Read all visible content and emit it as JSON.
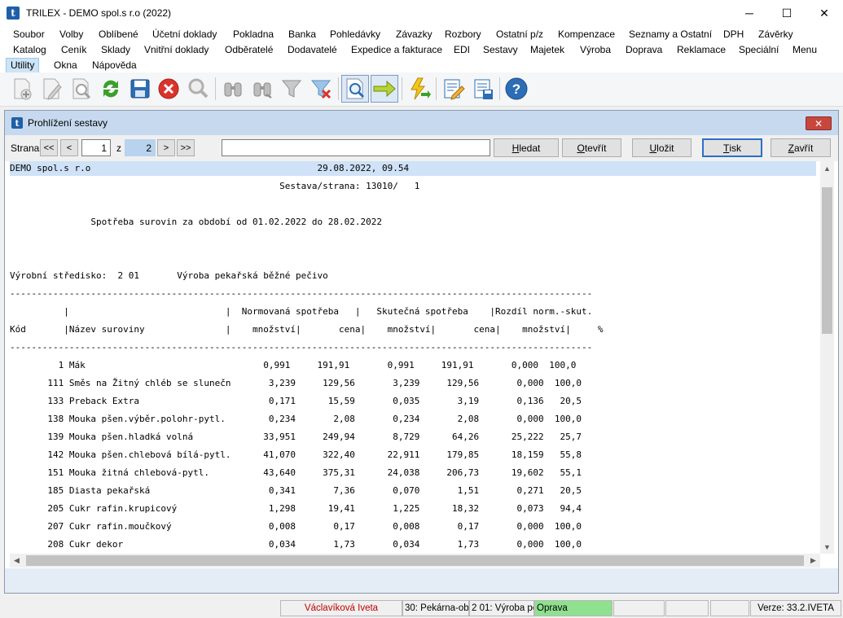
{
  "window": {
    "title": "TRILEX - DEMO spol.s r.o (2022)",
    "logo_letter": "t",
    "minimize": "─",
    "maximize": "☐",
    "close": "✕"
  },
  "menu": {
    "row1": [
      "Soubor",
      "Volby",
      "Oblíbené",
      "Účetní doklady",
      "Pokladna",
      "Banka",
      "Pohledávky",
      "Závazky",
      "Rozbory",
      "Ostatní p/z",
      "Kompenzace",
      "Seznamy a Ostatní",
      "DPH",
      "Závěrky"
    ],
    "row2": [
      "Katalog",
      "Ceník",
      "Sklady",
      "Vnitřní doklady",
      "Odběratelé",
      "Dodavatelé",
      "Expedice a fakturace",
      "EDI",
      "Sestavy",
      "Majetek",
      "Výroba",
      "Doprava",
      "Reklamace",
      "Speciální",
      "Menu"
    ],
    "row3": [
      "Utility",
      "Okna",
      "Nápověda"
    ],
    "active": "Utility"
  },
  "toolbar": {
    "icons": [
      "new-document-icon",
      "edit-document-icon",
      "preview-document-icon",
      "refresh-icon",
      "save-icon",
      "delete-icon",
      "search-icon",
      "find-icon",
      "find-next-icon",
      "filter-icon",
      "clear-filter-icon",
      "print-preview-icon",
      "export-arrow-icon",
      "run-icon",
      "edit-form-icon",
      "save-form-icon",
      "help-icon"
    ],
    "help_glyph": "?"
  },
  "dialog": {
    "title": "Prohlížení sestavy",
    "close_glyph": "✕",
    "nav": {
      "page_label": "Strana",
      "first": "<<",
      "prev": "<",
      "current_page": "1",
      "of_label": "z",
      "total_pages": "2",
      "next": ">",
      "last": ">>",
      "search_value": ""
    },
    "buttons": {
      "find": "Hledat",
      "open": "Otevřít",
      "save": "Uložit",
      "print": "Tisk",
      "close": "Zavřít"
    }
  },
  "report": {
    "lines": [
      "DEMO spol.s r.o                                          29.08.2022, 09.54",
      "                                                  Sestava/strana: 13010/   1",
      "",
      "               Spotřeba surovin za období od 01.02.2022 do 28.02.2022",
      "",
      "",
      "Výrobní středisko:  2 01       Výroba pekařská běžné pečivo",
      "------------------------------------------------------------------------------------------------------------",
      "          |                             |  Normovaná spotřeba   |   Skutečná spotřeba    |Rozdíl norm.-skut.",
      "Kód       |Název suroviny               |    množství|       cena|    množství|       cena|    množství|     %",
      "------------------------------------------------------------------------------------------------------------",
      "         1 Mák                                 0,991     191,91       0,991     191,91       0,000  100,0",
      "       111 Směs na Žitný chléb se slunečn       3,239     129,56       3,239     129,56       0,000  100,0",
      "       133 Preback Extra                        0,171      15,59       0,035       3,19       0,136   20,5",
      "       138 Mouka pšen.výběr.polohr-pytl.        0,234       2,08       0,234       2,08       0,000  100,0",
      "       139 Mouka pšen.hladká volná             33,951     249,94       8,729      64,26      25,222   25,7",
      "       142 Mouka pšen.chlebová bílá-pytl.      41,070     322,40      22,911     179,85      18,159   55,8",
      "       151 Mouka žitná chlebová-pytl.          43,640     375,31      24,038     206,73      19,602   55,1",
      "       185 Diasta pekařská                      0,341       7,36       0,070       1,51       0,271   20,5",
      "       205 Cukr rafin.krupicový                 1,298      19,41       1,225      18,32       0,073   94,4",
      "       207 Cukr rafin.moučkový                  0,008       0,17       0,008       0,17       0,000  100,0",
      "       208 Cukr dekor                           0,034       1,73       0,034       1,73       0,000  100,0"
    ]
  },
  "statusbar": {
    "user": "Václavíková Iveta",
    "branch": "30: Pekárna-ob",
    "center": "2 01: Výroba pe",
    "mode": "Oprava",
    "version": "Verze: 33.2.IVETA",
    "colors": {
      "user_text": "#c00000",
      "mode_bg": "#8fe08f"
    }
  }
}
